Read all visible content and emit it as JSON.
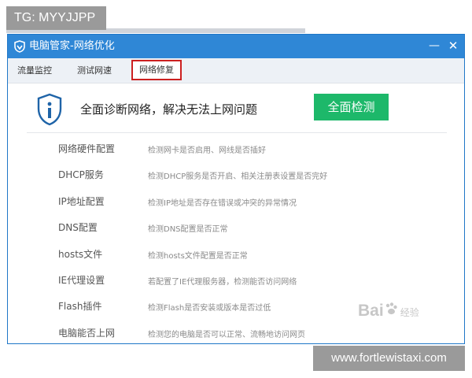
{
  "overlay": {
    "tg": "TG: MYYJJPP",
    "site": "www.fortlewistaxi.com",
    "watermark": "Bai",
    "watermark_sub": "经验"
  },
  "window": {
    "title": "电脑管家-网络优化",
    "minimize": "—",
    "close": "✕"
  },
  "tabs": [
    {
      "label": "流量监控"
    },
    {
      "label": "测试网速"
    },
    {
      "label": "网络修复",
      "selected": true
    }
  ],
  "diagnose": {
    "text": "全面诊断网络，解决无法上网问题",
    "button": "全面检测"
  },
  "checks": [
    {
      "name": "网络硬件配置",
      "desc": "检测网卡是否启用、网线是否插好"
    },
    {
      "name": "DHCP服务",
      "desc": "检测DHCP服务是否开启、相关注册表设置是否完好"
    },
    {
      "name": "IP地址配置",
      "desc": "检测IP地址是否存在错误或冲突的异常情况"
    },
    {
      "name": "DNS配置",
      "desc": "检测DNS配置是否正常"
    },
    {
      "name": "hosts文件",
      "desc": "检测hosts文件配置是否正常"
    },
    {
      "name": "IE代理设置",
      "desc": "若配置了IE代理服务器，检测能否访问网络"
    },
    {
      "name": "Flash插件",
      "desc": "检测Flash是否安装或版本是否过低"
    },
    {
      "name": "电脑能否上网",
      "desc": "检测您的电脑是否可以正常、流畅地访问网页"
    }
  ],
  "colors": {
    "titlebar": "#2f87d6",
    "accent_green": "#1db86a",
    "selected_tab_border": "#cc2020",
    "shield_blue": "#1f64a8"
  }
}
